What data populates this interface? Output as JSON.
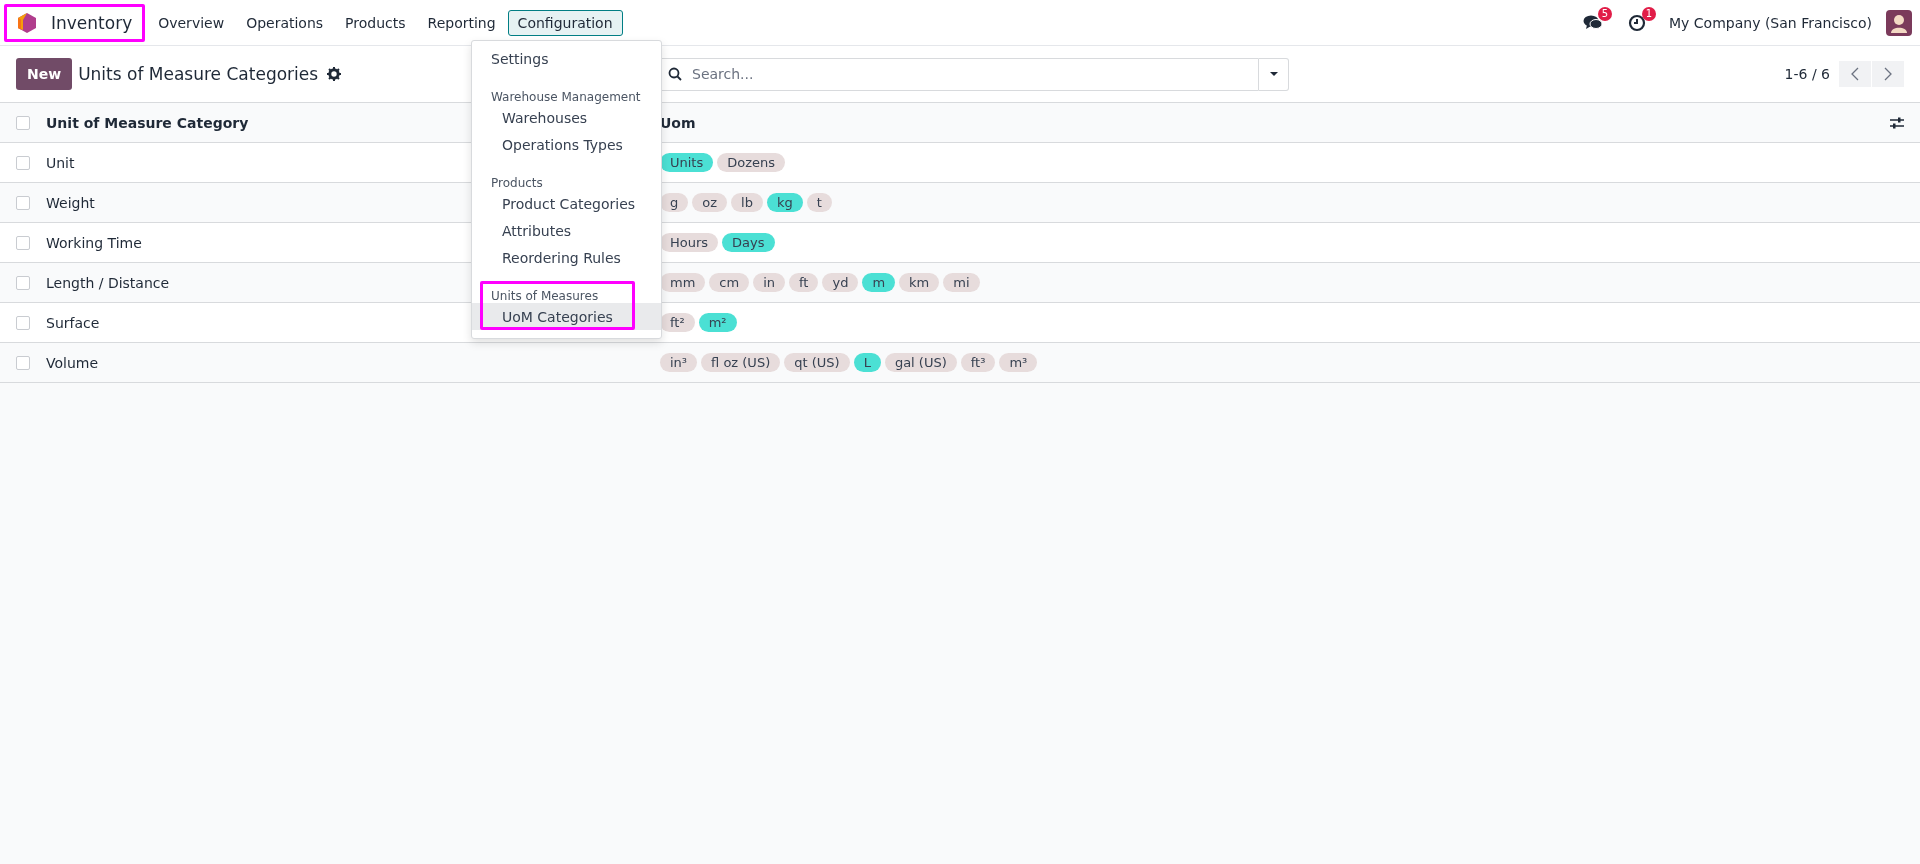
{
  "navbar": {
    "app": {
      "name": "Inventory",
      "highlighted": true
    },
    "menus": [
      {
        "label": "Overview",
        "selected": false
      },
      {
        "label": "Operations",
        "selected": false
      },
      {
        "label": "Products",
        "selected": false
      },
      {
        "label": "Reporting",
        "selected": false
      },
      {
        "label": "Configuration",
        "selected": true
      }
    ],
    "messages_count": "5",
    "activities_count": "1",
    "company": "My Company (San Francisco)"
  },
  "dropdown": {
    "entries": [
      {
        "kind": "item",
        "label": "Settings",
        "selected": false,
        "highlighted": false
      },
      {
        "kind": "header",
        "label": "Warehouse Management",
        "highlighted": false
      },
      {
        "kind": "subitem",
        "label": "Warehouses",
        "selected": false,
        "highlighted": false
      },
      {
        "kind": "subitem",
        "label": "Operations Types",
        "selected": false,
        "highlighted": false
      },
      {
        "kind": "header",
        "label": "Products",
        "highlighted": false
      },
      {
        "kind": "subitem",
        "label": "Product Categories",
        "selected": false,
        "highlighted": false
      },
      {
        "kind": "subitem",
        "label": "Attributes",
        "selected": false,
        "highlighted": false
      },
      {
        "kind": "subitem",
        "label": "Reordering Rules",
        "selected": false,
        "highlighted": false
      },
      {
        "kind": "header",
        "label": "Units of Measures",
        "highlighted": true
      },
      {
        "kind": "subitem",
        "label": "UoM Categories",
        "selected": true,
        "highlighted": true
      }
    ]
  },
  "control_panel": {
    "new_button": "New",
    "title": "Units of Measure Categories",
    "search": {
      "placeholder": "Search..."
    },
    "pager": "1-6 / 6"
  },
  "table": {
    "all_checked": false,
    "columns": [
      "Unit of Measure Category",
      "Uom"
    ],
    "rows": [
      {
        "name": "Unit",
        "checked": false,
        "uoms": [
          {
            "label": "Units",
            "reference": true
          },
          {
            "label": "Dozens",
            "reference": false
          }
        ]
      },
      {
        "name": "Weight",
        "checked": false,
        "uoms": [
          {
            "label": "g",
            "reference": false
          },
          {
            "label": "oz",
            "reference": false
          },
          {
            "label": "lb",
            "reference": false
          },
          {
            "label": "kg",
            "reference": true
          },
          {
            "label": "t",
            "reference": false
          }
        ]
      },
      {
        "name": "Working Time",
        "checked": false,
        "uoms": [
          {
            "label": "Hours",
            "reference": false
          },
          {
            "label": "Days",
            "reference": true
          }
        ]
      },
      {
        "name": "Length / Distance",
        "checked": false,
        "uoms": [
          {
            "label": "mm",
            "reference": false
          },
          {
            "label": "cm",
            "reference": false
          },
          {
            "label": "in",
            "reference": false
          },
          {
            "label": "ft",
            "reference": false
          },
          {
            "label": "yd",
            "reference": false
          },
          {
            "label": "m",
            "reference": true
          },
          {
            "label": "km",
            "reference": false
          },
          {
            "label": "mi",
            "reference": false
          }
        ]
      },
      {
        "name": "Surface",
        "checked": false,
        "uoms": [
          {
            "label": "ft²",
            "reference": false
          },
          {
            "label": "m²",
            "reference": true
          }
        ]
      },
      {
        "name": "Volume",
        "checked": false,
        "uoms": [
          {
            "label": "in³",
            "reference": false
          },
          {
            "label": "fl oz (US)",
            "reference": false
          },
          {
            "label": "qt (US)",
            "reference": false
          },
          {
            "label": "L",
            "reference": true
          },
          {
            "label": "gal (US)",
            "reference": false
          },
          {
            "label": "ft³",
            "reference": false
          },
          {
            "label": "m³",
            "reference": false
          }
        ]
      }
    ]
  }
}
